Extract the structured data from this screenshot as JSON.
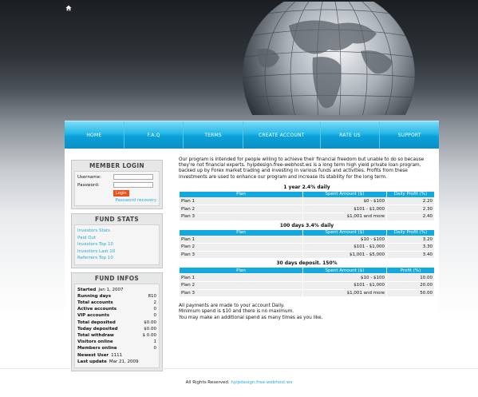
{
  "nav": {
    "items": [
      "HOME",
      "F.A.Q",
      "TERMS",
      "CREATE ACCOUNT",
      "RATE US",
      "SUPPORT"
    ]
  },
  "login": {
    "title": "MEMBER LOGIN",
    "username_label": "Username:",
    "password_label": "Password:",
    "button": "Login",
    "recovery": "Password recovery"
  },
  "fund_stats": {
    "title": "FUND STATS",
    "links": [
      "Investors Stats",
      "Paid Out",
      "Investors Top 10",
      "Investors Last 10",
      "Referrers Top 10"
    ]
  },
  "fund_infos": {
    "title": "FUND INFOS",
    "started_label": "Started",
    "started_value": "Jan 1, 2007",
    "rows": [
      {
        "label": "Running days",
        "value": "810"
      },
      {
        "label": "Total accounts",
        "value": "2"
      },
      {
        "label": "Active accounts",
        "value": "0"
      },
      {
        "label": "VIP accounts",
        "value": "0"
      },
      {
        "label": "Total deposited",
        "value": "$0.00"
      },
      {
        "label": "Today deposited",
        "value": "$0.00"
      },
      {
        "label": "Total withdraw",
        "value": "$ 0.00"
      },
      {
        "label": "Visitors online",
        "value": "1"
      },
      {
        "label": "Members online",
        "value": "0"
      }
    ],
    "newest_label": "Newest User",
    "newest_value": "1111",
    "last_update_label": "Last update",
    "last_update_value": "Mar 21, 2009"
  },
  "main": {
    "intro": "Our program is intended for people willing to achieve their financial freedom but unable to do so because they're not financial experts. hyipdesign.free-webhost.ws is a long term high yield private loan program, backed up by Forex market trading and investing in various funds and activities. Profits from these investments are used to enhance our program and increase its stability for the long term.",
    "plans": [
      {
        "title": "1 year 2.4% daily",
        "headers": [
          "Plan",
          "Spent Amount ($)",
          "Daily Profit (%)"
        ],
        "rows": [
          [
            "Plan 1",
            "$0 - $100",
            "2.20"
          ],
          [
            "Plan 2",
            "$101 - $1,000",
            "2.30"
          ],
          [
            "Plan 3",
            "$1,001 and more",
            "2.40"
          ]
        ]
      },
      {
        "title": "100 days 3.4% daily",
        "headers": [
          "Plan",
          "Spent Amount ($)",
          "Daily Profit (%)"
        ],
        "rows": [
          [
            "Plan 1",
            "$10 - $100",
            "3.20"
          ],
          [
            "Plan 2",
            "$101 - $1,000",
            "3.30"
          ],
          [
            "Plan 3",
            "$1,001 - $5,000",
            "3.40"
          ]
        ]
      },
      {
        "title": "30 days deposit. 150%",
        "headers": [
          "Plan",
          "Spent Amount ($)",
          "Profit (%)"
        ],
        "rows": [
          [
            "Plan 1",
            "$10 - $100",
            "10.00"
          ],
          [
            "Plan 2",
            "$101 - $1,000",
            "20.00"
          ],
          [
            "Plan 3",
            "$1,001 and more",
            "50.00"
          ]
        ]
      }
    ],
    "notes": [
      "All payments are made to your account Daily.",
      "Minimum spend is $10 and there is no maximum.",
      "You may make an additional spend as many times as you like."
    ]
  },
  "footer": {
    "text": "All Rights Reserved.",
    "link": "hyipdesign.free-webhost.ws"
  },
  "colors": {
    "accent": "#12a8e0",
    "link": "#23a8d8",
    "button": "#f04e1a"
  }
}
